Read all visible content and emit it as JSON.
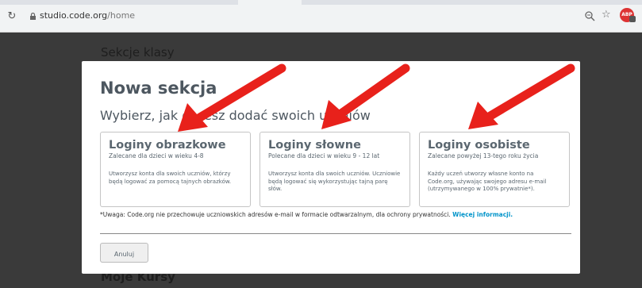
{
  "browser": {
    "url_domain": "studio.code.org",
    "url_path": "/home",
    "extension_label": "ABP"
  },
  "background_page": {
    "heading": "Sekcje klasy",
    "heading2": "Moje Kursy"
  },
  "dialog": {
    "title": "Nowa sekcja",
    "subtitle": "Wybierz, jak chcesz dodać swoich uczniów",
    "cards": [
      {
        "title": "Loginy obrazkowe",
        "subtitle": "Zalecane dla dzieci w wieku 4-8",
        "description": "Utworzysz konta dla swoich uczniów, którzy będą logować za pomocą tajnych obrazków."
      },
      {
        "title": "Loginy słowne",
        "subtitle": "Polecane dla dzieci w wieku 9 - 12 lat",
        "description": "Utworzysz konta dla swoich uczniów. Uczniowie będą logować się wykorzystując tajną parę słów."
      },
      {
        "title": "Loginy osobiste",
        "subtitle": "Zalecane powyżej 13-tego roku życia",
        "description": "Każdy uczeń utworzy własne konto na Code.org, używając swojego adresu e-mail (utrzymywanego w 100% prywatnie*)."
      }
    ],
    "note_text": "*Uwaga: Code.org nie przechowuje uczniowskich adresów e-mail w formacie odtwarzalnym, dla ochrony prywatności. ",
    "note_link": "Więcej informacji.",
    "cancel_label": "Anuluj"
  },
  "colors": {
    "overlay": "#3a3a3a",
    "arrow": "#e8211b",
    "link": "#0094ca",
    "text": "#5b6770"
  }
}
